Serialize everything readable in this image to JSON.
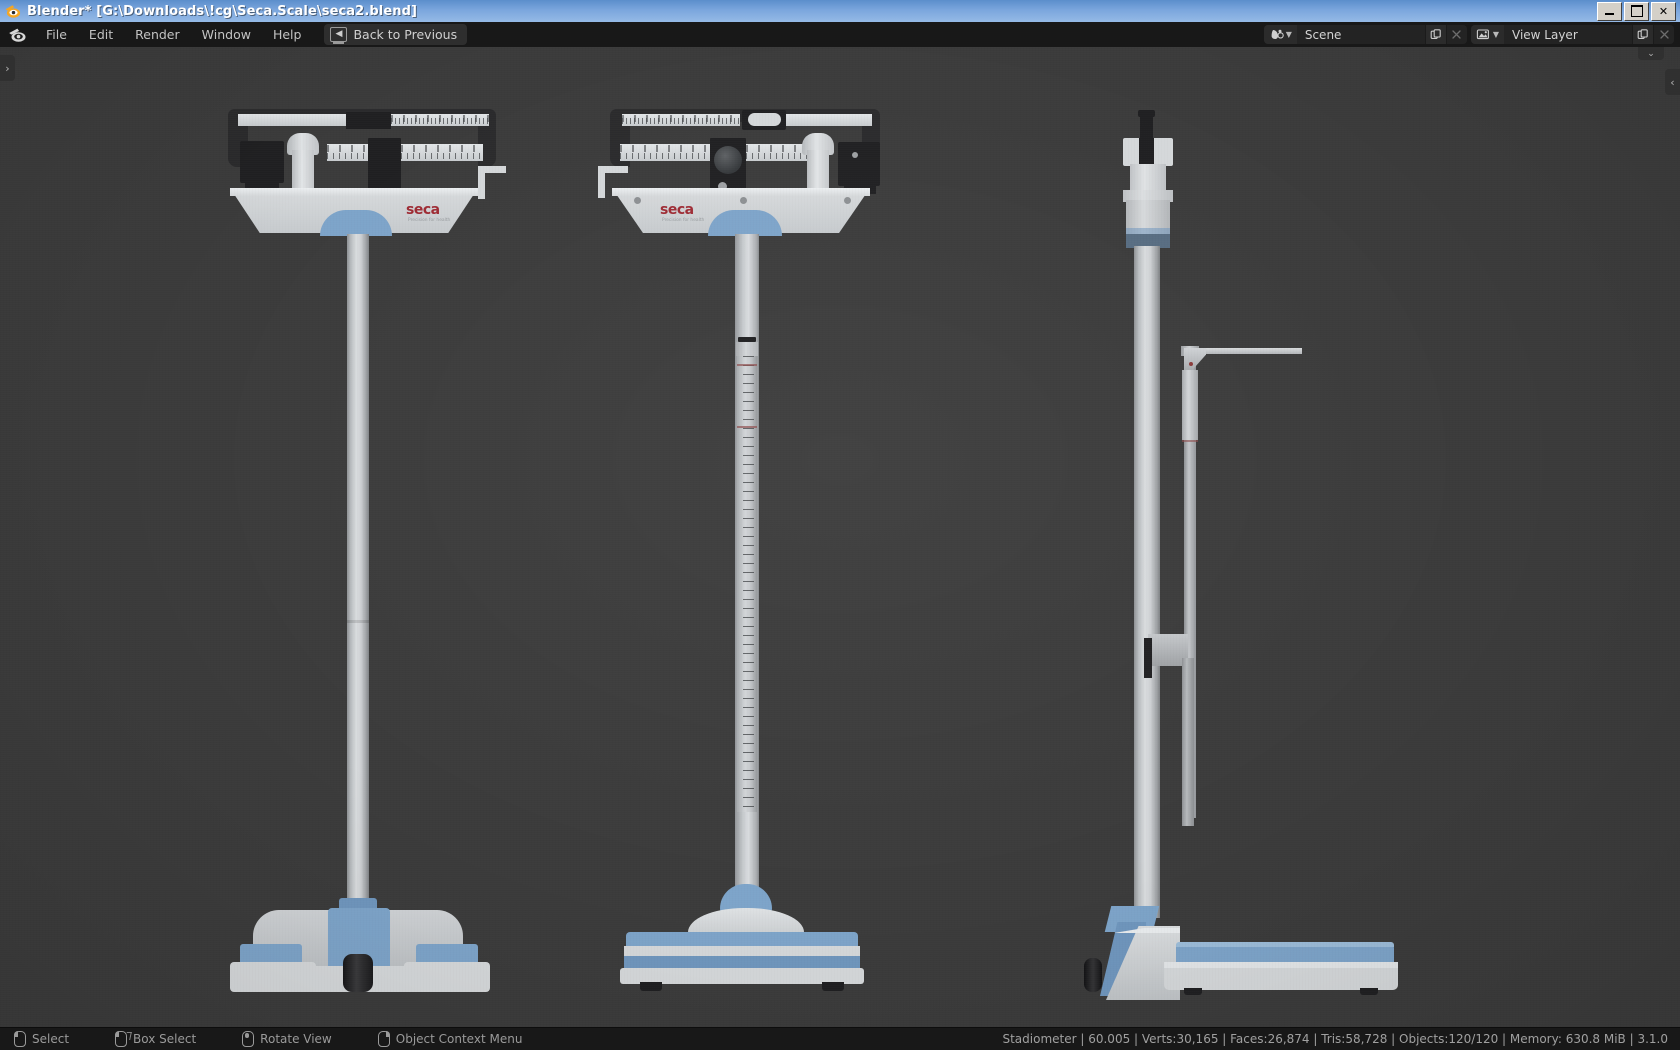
{
  "window": {
    "title": "Blender* [G:\\Downloads\\!cg\\Seca.Scale\\seca2.blend]",
    "app_icon": "blender-logo-icon",
    "controls": {
      "minimize": "–",
      "restore": "❐",
      "close": "✕"
    },
    "titlebar_color": "#7ba6dd"
  },
  "topbar": {
    "logo": "blender-logo-icon",
    "menus": [
      {
        "label": "File"
      },
      {
        "label": "Edit"
      },
      {
        "label": "Render"
      },
      {
        "label": "Window"
      },
      {
        "label": "Help"
      }
    ],
    "workspace_button": {
      "label": "Back to Previous",
      "icon": "screen-back-icon"
    },
    "scene": {
      "icon": "scene-icon",
      "name": "Scene",
      "new_icon": "duplicate-icon",
      "unlink_icon": "close-icon"
    },
    "view_layer": {
      "icon": "view-layer-icon",
      "name": "View Layer",
      "new_icon": "duplicate-icon",
      "remove_icon": "close-icon"
    }
  },
  "viewport": {
    "background_color": "#3b3b3b",
    "sidebar_toggles": {
      "left": "›",
      "right": "‹",
      "top": "⌄"
    },
    "models": [
      {
        "name": "seca-scale-front-view",
        "view": "front"
      },
      {
        "name": "seca-scale-rear-view",
        "view": "rear"
      },
      {
        "name": "seca-scale-side-view",
        "view": "side"
      }
    ],
    "brand": {
      "name": "seca",
      "tagline": "Precision for health",
      "color": "#9e2a33"
    },
    "material_colors": {
      "white": "#c9ccce",
      "blue": "#7da4c9",
      "dark": "#2a2a2c"
    }
  },
  "statusbar": {
    "keymap": [
      {
        "icon": "mouse-left-icon",
        "label": "Select"
      },
      {
        "icon": "mouse-left-drag-icon",
        "label": "Box Select"
      },
      {
        "icon": "mouse-middle-icon",
        "label": "Rotate View"
      },
      {
        "icon": "mouse-right-icon",
        "label": "Object Context Menu"
      }
    ],
    "info": "Stadiometer | 60.005 | Verts:30,165 | Faces:26,874 | Tris:58,728 | Objects:120/120 | Memory: 630.8 MiB | 3.1.0",
    "active_object": "Stadiometer",
    "scene_stat": "60.005",
    "verts": "30,165",
    "faces": "26,874",
    "tris": "58,728",
    "objects": "120/120",
    "memory": "630.8 MiB",
    "version": "3.1.0"
  }
}
